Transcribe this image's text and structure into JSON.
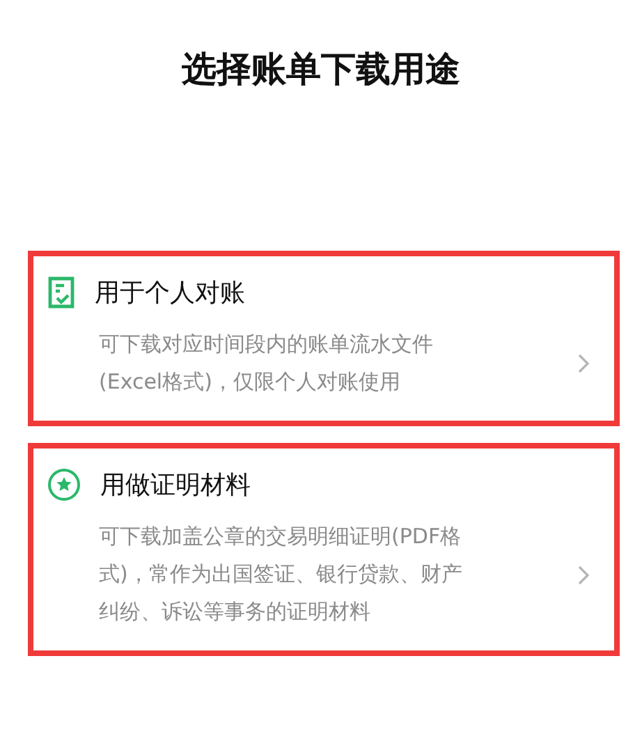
{
  "title": "选择账单下载用途",
  "options": [
    {
      "kind": "reconcile",
      "title": "用于个人对账",
      "description_lines": [
        "可下载对应时间段内的账单流水文件",
        "(Excel格式)，仅限个人对账使用"
      ],
      "highlighted": true
    },
    {
      "kind": "proof",
      "title": "用做证明材料",
      "description_lines": [
        "可下载加盖公章的交易明细证明(PDF格",
        "式)，常作为出国签证、银行贷款、财产",
        "纠纷、诉讼等事务的证明材料"
      ],
      "highlighted": true
    }
  ]
}
